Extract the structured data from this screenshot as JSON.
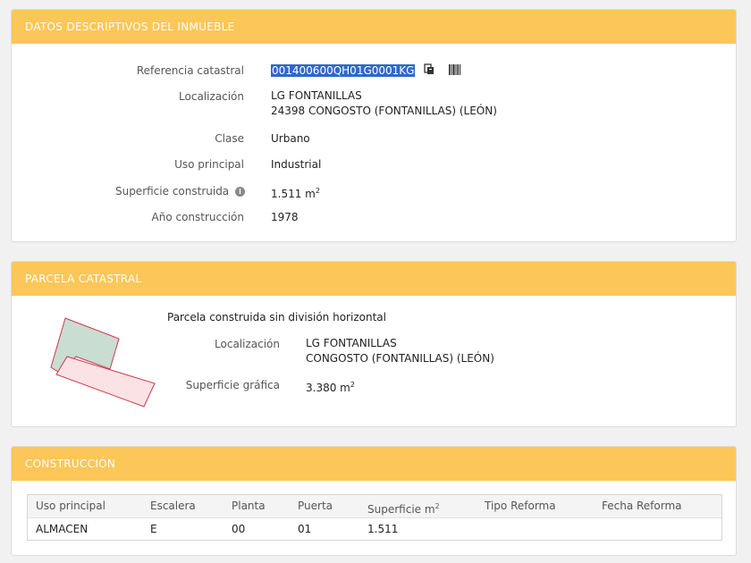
{
  "inmueble": {
    "header": "DATOS DESCRIPTIVOS DEL INMUEBLE",
    "fields": {
      "referencia_label": "Referencia catastral",
      "referencia_value": "001400600QH01G0001KG",
      "localizacion_label": "Localización",
      "localizacion_line1": "LG FONTANILLAS",
      "localizacion_line2": "24398 CONGOSTO (FONTANILLAS) (LEÓN)",
      "clase_label": "Clase",
      "clase_value": "Urbano",
      "uso_label": "Uso principal",
      "uso_value": "Industrial",
      "superficie_label": "Superficie construida",
      "superficie_value": "1.511 m",
      "superficie_sup": "2",
      "anio_label": "Año construcción",
      "anio_value": "1978"
    }
  },
  "parcela": {
    "header": "PARCELA CATASTRAL",
    "description": "Parcela construida sin división horizontal",
    "localizacion_label": "Localización",
    "localizacion_line1": "LG FONTANILLAS",
    "localizacion_line2": "CONGOSTO (FONTANILLAS) (LEÓN)",
    "superficie_label": "Superficie gráfica",
    "superficie_value": "3.380 m",
    "superficie_sup": "2",
    "map_colors": {
      "parcel_fill": "#c9ddd2",
      "building_fill": "#fbe2e4",
      "outline": "#c93b4d"
    }
  },
  "construccion": {
    "header": "CONSTRUCCIÓN",
    "columns": [
      "Uso principal",
      "Escalera",
      "Planta",
      "Puerta",
      "Superficie m",
      "Tipo Reforma",
      "Fecha Reforma"
    ],
    "superficie_sup": "2",
    "rows": [
      [
        "ALMACEN",
        "E",
        "00",
        "01",
        "1.511",
        "",
        ""
      ]
    ]
  },
  "colors": {
    "header_bg": "#fcc758",
    "selection": "#3168c6"
  },
  "icons": {
    "copy": "copy-icon",
    "barcode": "barcode-icon",
    "info": "info-icon"
  }
}
